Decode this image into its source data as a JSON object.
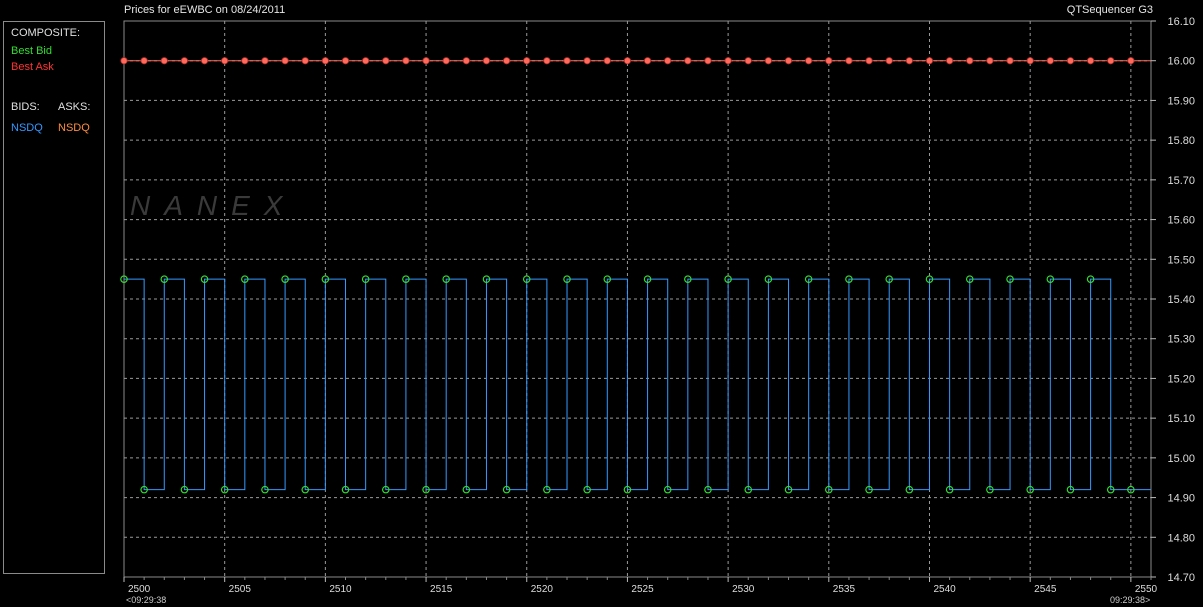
{
  "header": {
    "title": "Prices for  eEWBC  on  08/24/2011",
    "app_name": "QTSequencer G3"
  },
  "legend": {
    "composite_label": "COMPOSITE:",
    "best_bid": "Best Bid",
    "best_ask": "Best Ask",
    "bids_label": "BIDS:",
    "asks_label": "ASKS:",
    "bid_exchange": "NSDQ",
    "ask_exchange": "NSDQ"
  },
  "watermark": "NANEX",
  "time_labels": {
    "start": "<09:29:38",
    "end": "09:29:38>"
  },
  "colors": {
    "best_bid": "#33dd33",
    "best_ask": "#ff3333",
    "bid_line": "#3399ff",
    "ask_line": "#ff6a5a",
    "ask_exchange_text": "#ff8c40",
    "grid": "#9a9a9a"
  },
  "chart_data": {
    "type": "line",
    "xlim": [
      2500,
      2551
    ],
    "ylim": [
      14.7,
      16.1
    ],
    "x_ticks": [
      2500,
      2505,
      2510,
      2515,
      2520,
      2525,
      2530,
      2535,
      2540,
      2545,
      2550
    ],
    "y_ticks": [
      "16.10",
      "16.00",
      "15.90",
      "15.80",
      "15.70",
      "15.60",
      "15.50",
      "15.40",
      "15.30",
      "15.20",
      "15.10",
      "15.00",
      "14.90",
      "14.80",
      "14.70"
    ],
    "grid": true,
    "series": [
      {
        "name": "Best Ask",
        "line": "NSDQ",
        "x": [
          2500,
          2501,
          2502,
          2503,
          2504,
          2505,
          2506,
          2507,
          2508,
          2509,
          2510,
          2511,
          2512,
          2513,
          2514,
          2515,
          2516,
          2517,
          2518,
          2519,
          2520,
          2521,
          2522,
          2523,
          2524,
          2525,
          2526,
          2527,
          2528,
          2529,
          2530,
          2531,
          2532,
          2533,
          2534,
          2535,
          2536,
          2537,
          2538,
          2539,
          2540,
          2541,
          2542,
          2543,
          2544,
          2545,
          2546,
          2547,
          2548,
          2549,
          2550
        ],
        "value": 16.0
      },
      {
        "name": "Best Bid",
        "line": "NSDQ",
        "x": [
          2500,
          2501,
          2502,
          2503,
          2504,
          2505,
          2506,
          2507,
          2508,
          2509,
          2510,
          2511,
          2512,
          2513,
          2514,
          2515,
          2516,
          2517,
          2518,
          2519,
          2520,
          2521,
          2522,
          2523,
          2524,
          2525,
          2526,
          2527,
          2528,
          2529,
          2530,
          2531,
          2532,
          2533,
          2534,
          2535,
          2536,
          2537,
          2538,
          2539,
          2540,
          2541,
          2542,
          2543,
          2544,
          2545,
          2546,
          2547,
          2548,
          2549,
          2550
        ],
        "values": [
          15.45,
          14.92,
          15.45,
          14.92,
          15.45,
          14.92,
          15.45,
          14.92,
          15.45,
          14.92,
          15.45,
          14.92,
          15.45,
          14.92,
          15.45,
          14.92,
          15.45,
          14.92,
          15.45,
          14.92,
          15.45,
          14.92,
          15.45,
          14.92,
          15.45,
          14.92,
          15.45,
          14.92,
          15.45,
          14.92,
          15.45,
          14.92,
          15.45,
          14.92,
          15.45,
          14.92,
          15.45,
          14.92,
          15.45,
          14.92,
          15.45,
          14.92,
          15.45,
          14.92,
          15.45,
          14.92,
          15.45,
          14.92,
          15.45,
          14.92,
          14.92
        ]
      }
    ]
  }
}
